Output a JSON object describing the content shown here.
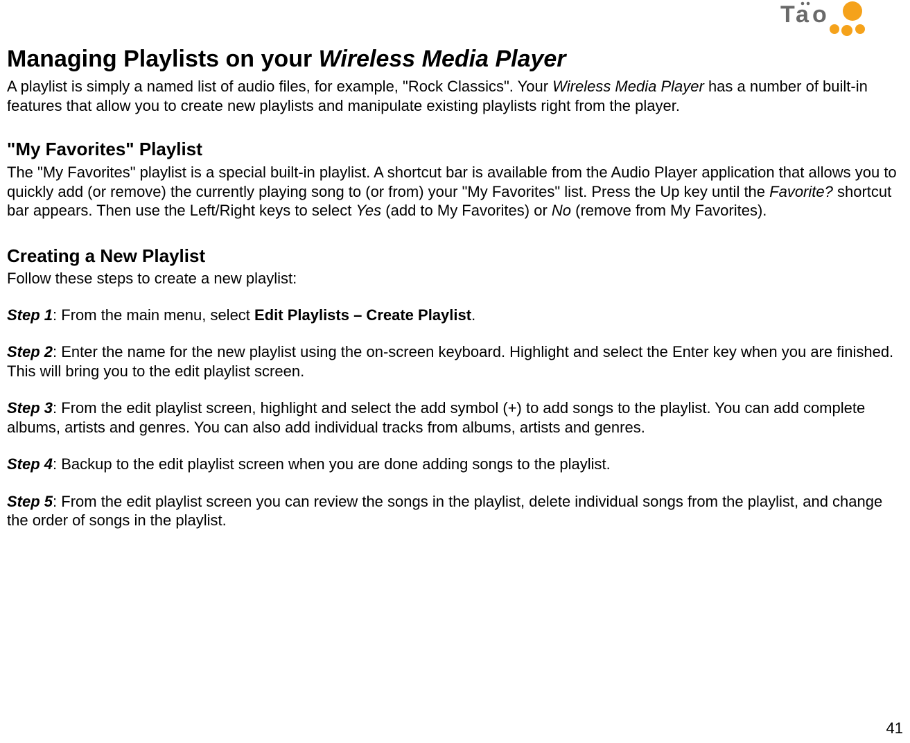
{
  "brand": {
    "name": "Tao"
  },
  "title": {
    "prefix": "Managing Playlists on your ",
    "italic": "Wireless Media Player"
  },
  "intro": {
    "part1": "A playlist is simply a named list of audio files, for example, \"Rock Classics\".  Your ",
    "product_italic": "Wireless Media Player",
    "part2": " has a number of built-in features that allow you to create new playlists and manipulate existing playlists right from the player."
  },
  "favorites": {
    "heading": "\"My Favorites\" Playlist",
    "part1": "The \"My Favorites\" playlist is a special built-in playlist.  A shortcut bar is available from the Audio Player application that allows you to quickly add (or remove) the currently playing song to (or from) your \"My Favorites\" list. Press the Up key until the ",
    "italic1": "Favorite?",
    "part2": "  shortcut bar appears.  Then use the Left/Right keys to select ",
    "italic2": "Yes",
    "part3": " (add to My Favorites) or ",
    "italic3": "No",
    "part4": " (remove from My Favorites)."
  },
  "creating": {
    "heading": "Creating a New Playlist",
    "intro": "Follow these steps to create a new playlist:",
    "steps": [
      {
        "label": "Step 1",
        "before": ": From the main menu, select ",
        "bold": "Edit Playlists – Create Playlist",
        "after": "."
      },
      {
        "label": "Step 2",
        "before": ": Enter the name for the new playlist using the on-screen keyboard.  Highlight and select the Enter key when you are finished.  This will bring you to the edit playlist screen.",
        "bold": "",
        "after": ""
      },
      {
        "label": "Step 3",
        "before": ": From the edit playlist screen, highlight and select the add symbol (+) to add songs to the playlist.  You can add complete albums, artists and genres.  You can also add individual tracks from albums, artists and genres.",
        "bold": "",
        "after": ""
      },
      {
        "label": "Step 4",
        "before": ": Backup to the edit playlist screen when you are done adding songs to the playlist.",
        "bold": "",
        "after": ""
      },
      {
        "label": "Step 5",
        "before": ": From the edit playlist screen you can review the songs in the playlist, delete individual songs from the playlist, and change the order of songs in the playlist.",
        "bold": "",
        "after": ""
      }
    ]
  },
  "page_number": "41"
}
